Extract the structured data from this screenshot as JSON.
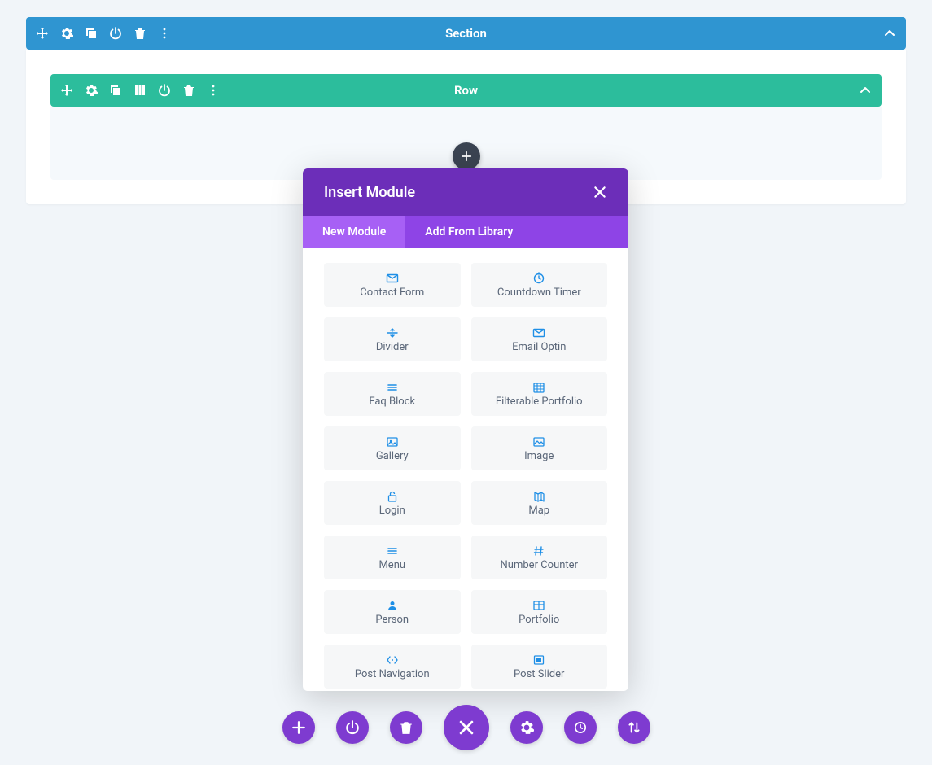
{
  "section": {
    "title": "Section"
  },
  "row": {
    "title": "Row"
  },
  "modal": {
    "title": "Insert Module",
    "tabs": {
      "new_module": "New Module",
      "add_from_library": "Add From Library"
    },
    "modules": [
      {
        "label": "Contact Form",
        "icon": "mail-icon"
      },
      {
        "label": "Countdown Timer",
        "icon": "clock-icon"
      },
      {
        "label": "Divider",
        "icon": "divider-icon"
      },
      {
        "label": "Email Optin",
        "icon": "mail-icon"
      },
      {
        "label": "Faq Block",
        "icon": "lines-icon"
      },
      {
        "label": "Filterable Portfolio",
        "icon": "grid-date-icon"
      },
      {
        "label": "Gallery",
        "icon": "gallery-icon"
      },
      {
        "label": "Image",
        "icon": "image-icon"
      },
      {
        "label": "Login",
        "icon": "lock-icon"
      },
      {
        "label": "Map",
        "icon": "map-icon"
      },
      {
        "label": "Menu",
        "icon": "lines-icon"
      },
      {
        "label": "Number Counter",
        "icon": "hash-icon"
      },
      {
        "label": "Person",
        "icon": "person-icon"
      },
      {
        "label": "Portfolio",
        "icon": "table-icon"
      },
      {
        "label": "Post Navigation",
        "icon": "code-icon"
      },
      {
        "label": "Post Slider",
        "icon": "slider-icon"
      }
    ]
  },
  "colors": {
    "section": "#2f95d1",
    "row": "#2cbd9c",
    "modal_header": "#6c2eb9",
    "modal_tabs": "#8e44e6",
    "modal_tab_active": "#a760f5",
    "accent": "#7e3bd0"
  }
}
